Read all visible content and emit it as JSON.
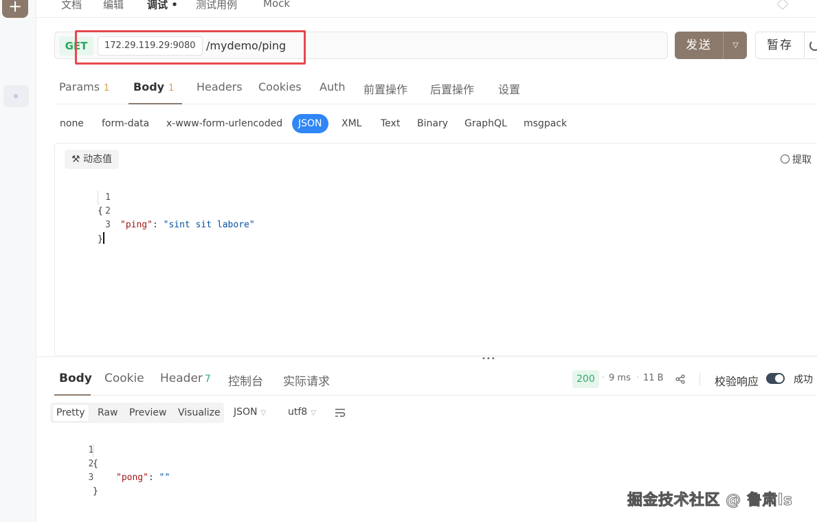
{
  "top_tabs": [
    {
      "label": "文档"
    },
    {
      "label": "编辑"
    },
    {
      "label": "调试 •"
    },
    {
      "label": "测试用例"
    },
    {
      "label": "Mock"
    }
  ],
  "request": {
    "method": "GET",
    "host": "172.29.119.29:9080",
    "path": "/mydemo/ping",
    "send_label": "发送",
    "save_label": "暂存"
  },
  "request_tabs": [
    {
      "label": "Params",
      "count": "1"
    },
    {
      "label": "Body",
      "count": "1"
    },
    {
      "label": "Headers"
    },
    {
      "label": "Cookies"
    },
    {
      "label": "Auth"
    },
    {
      "label": "前置操作"
    },
    {
      "label": "后置操作"
    },
    {
      "label": "设置"
    }
  ],
  "body_types": [
    "none",
    "form-data",
    "x-www-form-urlencoded",
    "JSON",
    "XML",
    "Text",
    "Binary",
    "GraphQL",
    "msgpack"
  ],
  "editor": {
    "dynamic_value_label": "动态值",
    "extract_label": "提取",
    "lines": [
      {
        "n": "1",
        "open": "{"
      },
      {
        "n": "2",
        "key": "\"ping\"",
        "colon": ": ",
        "value": "\"sint sit labore\""
      },
      {
        "n": "3",
        "close": "}"
      }
    ]
  },
  "response": {
    "tabs": [
      {
        "label": "Body"
      },
      {
        "label": "Cookie"
      },
      {
        "label": "Header",
        "count": "7"
      },
      {
        "label": "控制台"
      },
      {
        "label": "实际请求"
      }
    ],
    "status": "200",
    "time": "9 ms",
    "size": "11 B",
    "validate_label": "校验响应",
    "result_label": "成功",
    "view_modes": [
      "Pretty",
      "Raw",
      "Preview",
      "Visualize"
    ],
    "format": "JSON",
    "encoding": "utf8",
    "lines": [
      {
        "n": "1",
        "open": "{"
      },
      {
        "n": "2",
        "key": "\"pong\"",
        "colon": ": ",
        "value": "\"\""
      },
      {
        "n": "3",
        "close": "}"
      }
    ]
  },
  "watermark": "掘金技术社区 @ 鲁肃ls",
  "colors": {
    "accent": "#8b7a6b",
    "method_get": "#26a85f",
    "json_active": "#2f86f6",
    "highlight_box": "#e5484d",
    "status_ok": "#2faa6a"
  }
}
